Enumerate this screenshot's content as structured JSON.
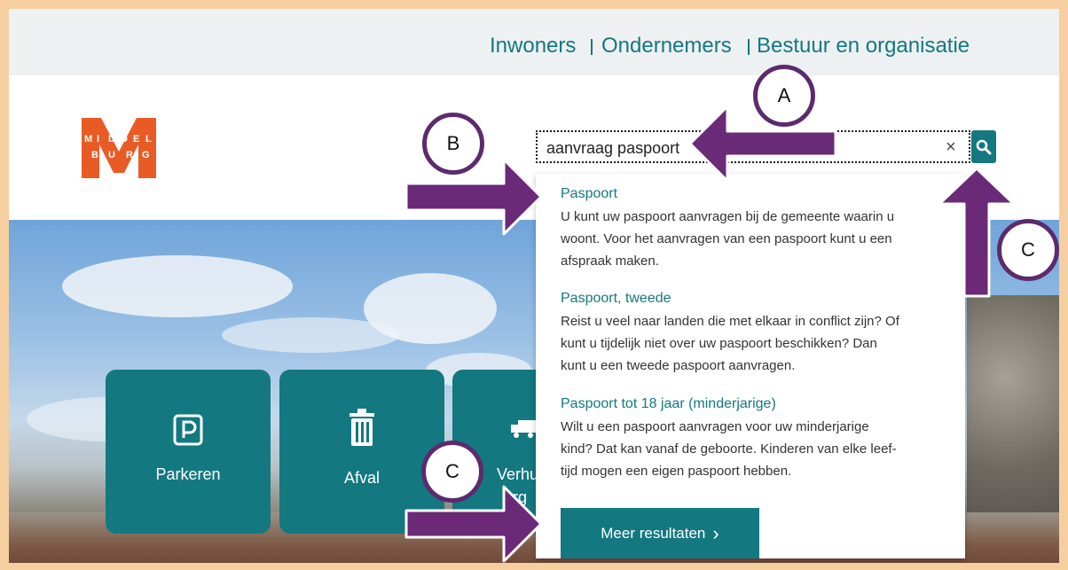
{
  "topnav": {
    "items": [
      "Inwoners",
      "Ondernemers",
      "Bestuur en organisatie"
    ]
  },
  "logo": {
    "letter": "M",
    "row1": [
      "M",
      "I",
      "D",
      "D",
      "E",
      "L"
    ],
    "row2": [
      "B",
      "U",
      "R",
      "G"
    ]
  },
  "search": {
    "value": "aanvraag paspoort",
    "clear_glyph": "×"
  },
  "results": [
    {
      "title": "Paspoort",
      "lines": [
        "U kunt uw paspoort aanvragen bij de gemeente waarin u",
        "woont. Voor het aanvragen van een paspoort kunt u een",
        "afspraak maken."
      ]
    },
    {
      "title": "Paspoort, tweede",
      "lines": [
        "Reist u veel naar landen die met elkaar in conflict zijn? Of",
        "kunt u tijdelijk niet over uw paspoort beschikken? Dan",
        "kunt u een tweede paspoort aanvragen."
      ]
    },
    {
      "title": "Paspoort tot 18 jaar (minderjarige)",
      "lines": [
        "Wilt u een paspoort aanvragen voor uw minderjarige",
        "kind? Dat kan vanaf de geboorte. Kinderen van elke leef-",
        "tijd mogen een eigen paspoort hebben."
      ]
    }
  ],
  "more_button": {
    "label": "Meer resultaten",
    "chevron": "›"
  },
  "tiles": [
    {
      "label": "Parkeren",
      "icon": "parking-icon"
    },
    {
      "label": "Afval",
      "icon": "trash-icon"
    },
    {
      "label": "Verhu",
      "label2": "org",
      "icon": "truck-icon"
    }
  ],
  "callouts": {
    "a": "A",
    "b": "B",
    "c1": "C",
    "c2": "C"
  },
  "colors": {
    "brand_teal": "#137880",
    "logo_orange": "#e95b25",
    "annotation_purple": "#6a2a78",
    "frame": "#f6cfa0"
  }
}
